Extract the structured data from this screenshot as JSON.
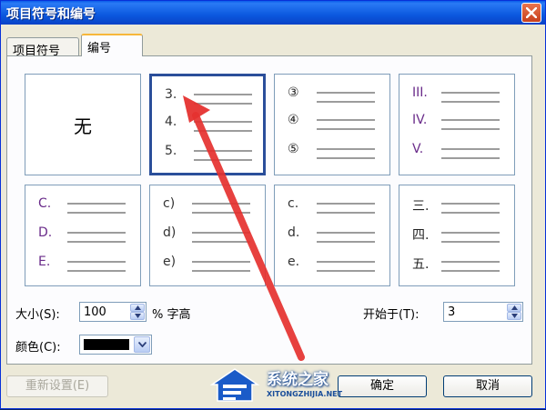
{
  "window": {
    "title": "项目符号和编号"
  },
  "tabs": [
    {
      "label": "项目符号",
      "active": false
    },
    {
      "label": "编号",
      "active": true
    }
  ],
  "grid": {
    "none_label": "无",
    "tiles": [
      {
        "markers": [
          "3.",
          "4.",
          "5."
        ],
        "selected": true,
        "color": "#333333"
      },
      {
        "markers": [
          "③",
          "④",
          "⑤"
        ],
        "selected": false,
        "color": "#222222"
      },
      {
        "markers": [
          "III.",
          "IV.",
          "V."
        ],
        "selected": false,
        "color": "#6a2c8a"
      },
      {
        "markers": [
          "C.",
          "D.",
          "E."
        ],
        "selected": false,
        "color": "#6a2c8a"
      },
      {
        "markers": [
          "c)",
          "d)",
          "e)"
        ],
        "selected": false,
        "color": "#333333"
      },
      {
        "markers": [
          "c.",
          "d.",
          "e."
        ],
        "selected": false,
        "color": "#333333"
      },
      {
        "markers": [
          "三.",
          "四.",
          "五."
        ],
        "selected": false,
        "color": "#222222"
      }
    ]
  },
  "size": {
    "label": "大小(S):",
    "value": "100",
    "suffix": "% 字高"
  },
  "start": {
    "label": "开始于(T):",
    "value": "3"
  },
  "color": {
    "label": "颜色(C):",
    "value": "#000000"
  },
  "buttons": {
    "reset": "重新设置(E)",
    "ok": "确定",
    "cancel": "取消"
  },
  "watermark": {
    "title": "系统之家",
    "url": "XITONGZHIJIA.NET"
  }
}
